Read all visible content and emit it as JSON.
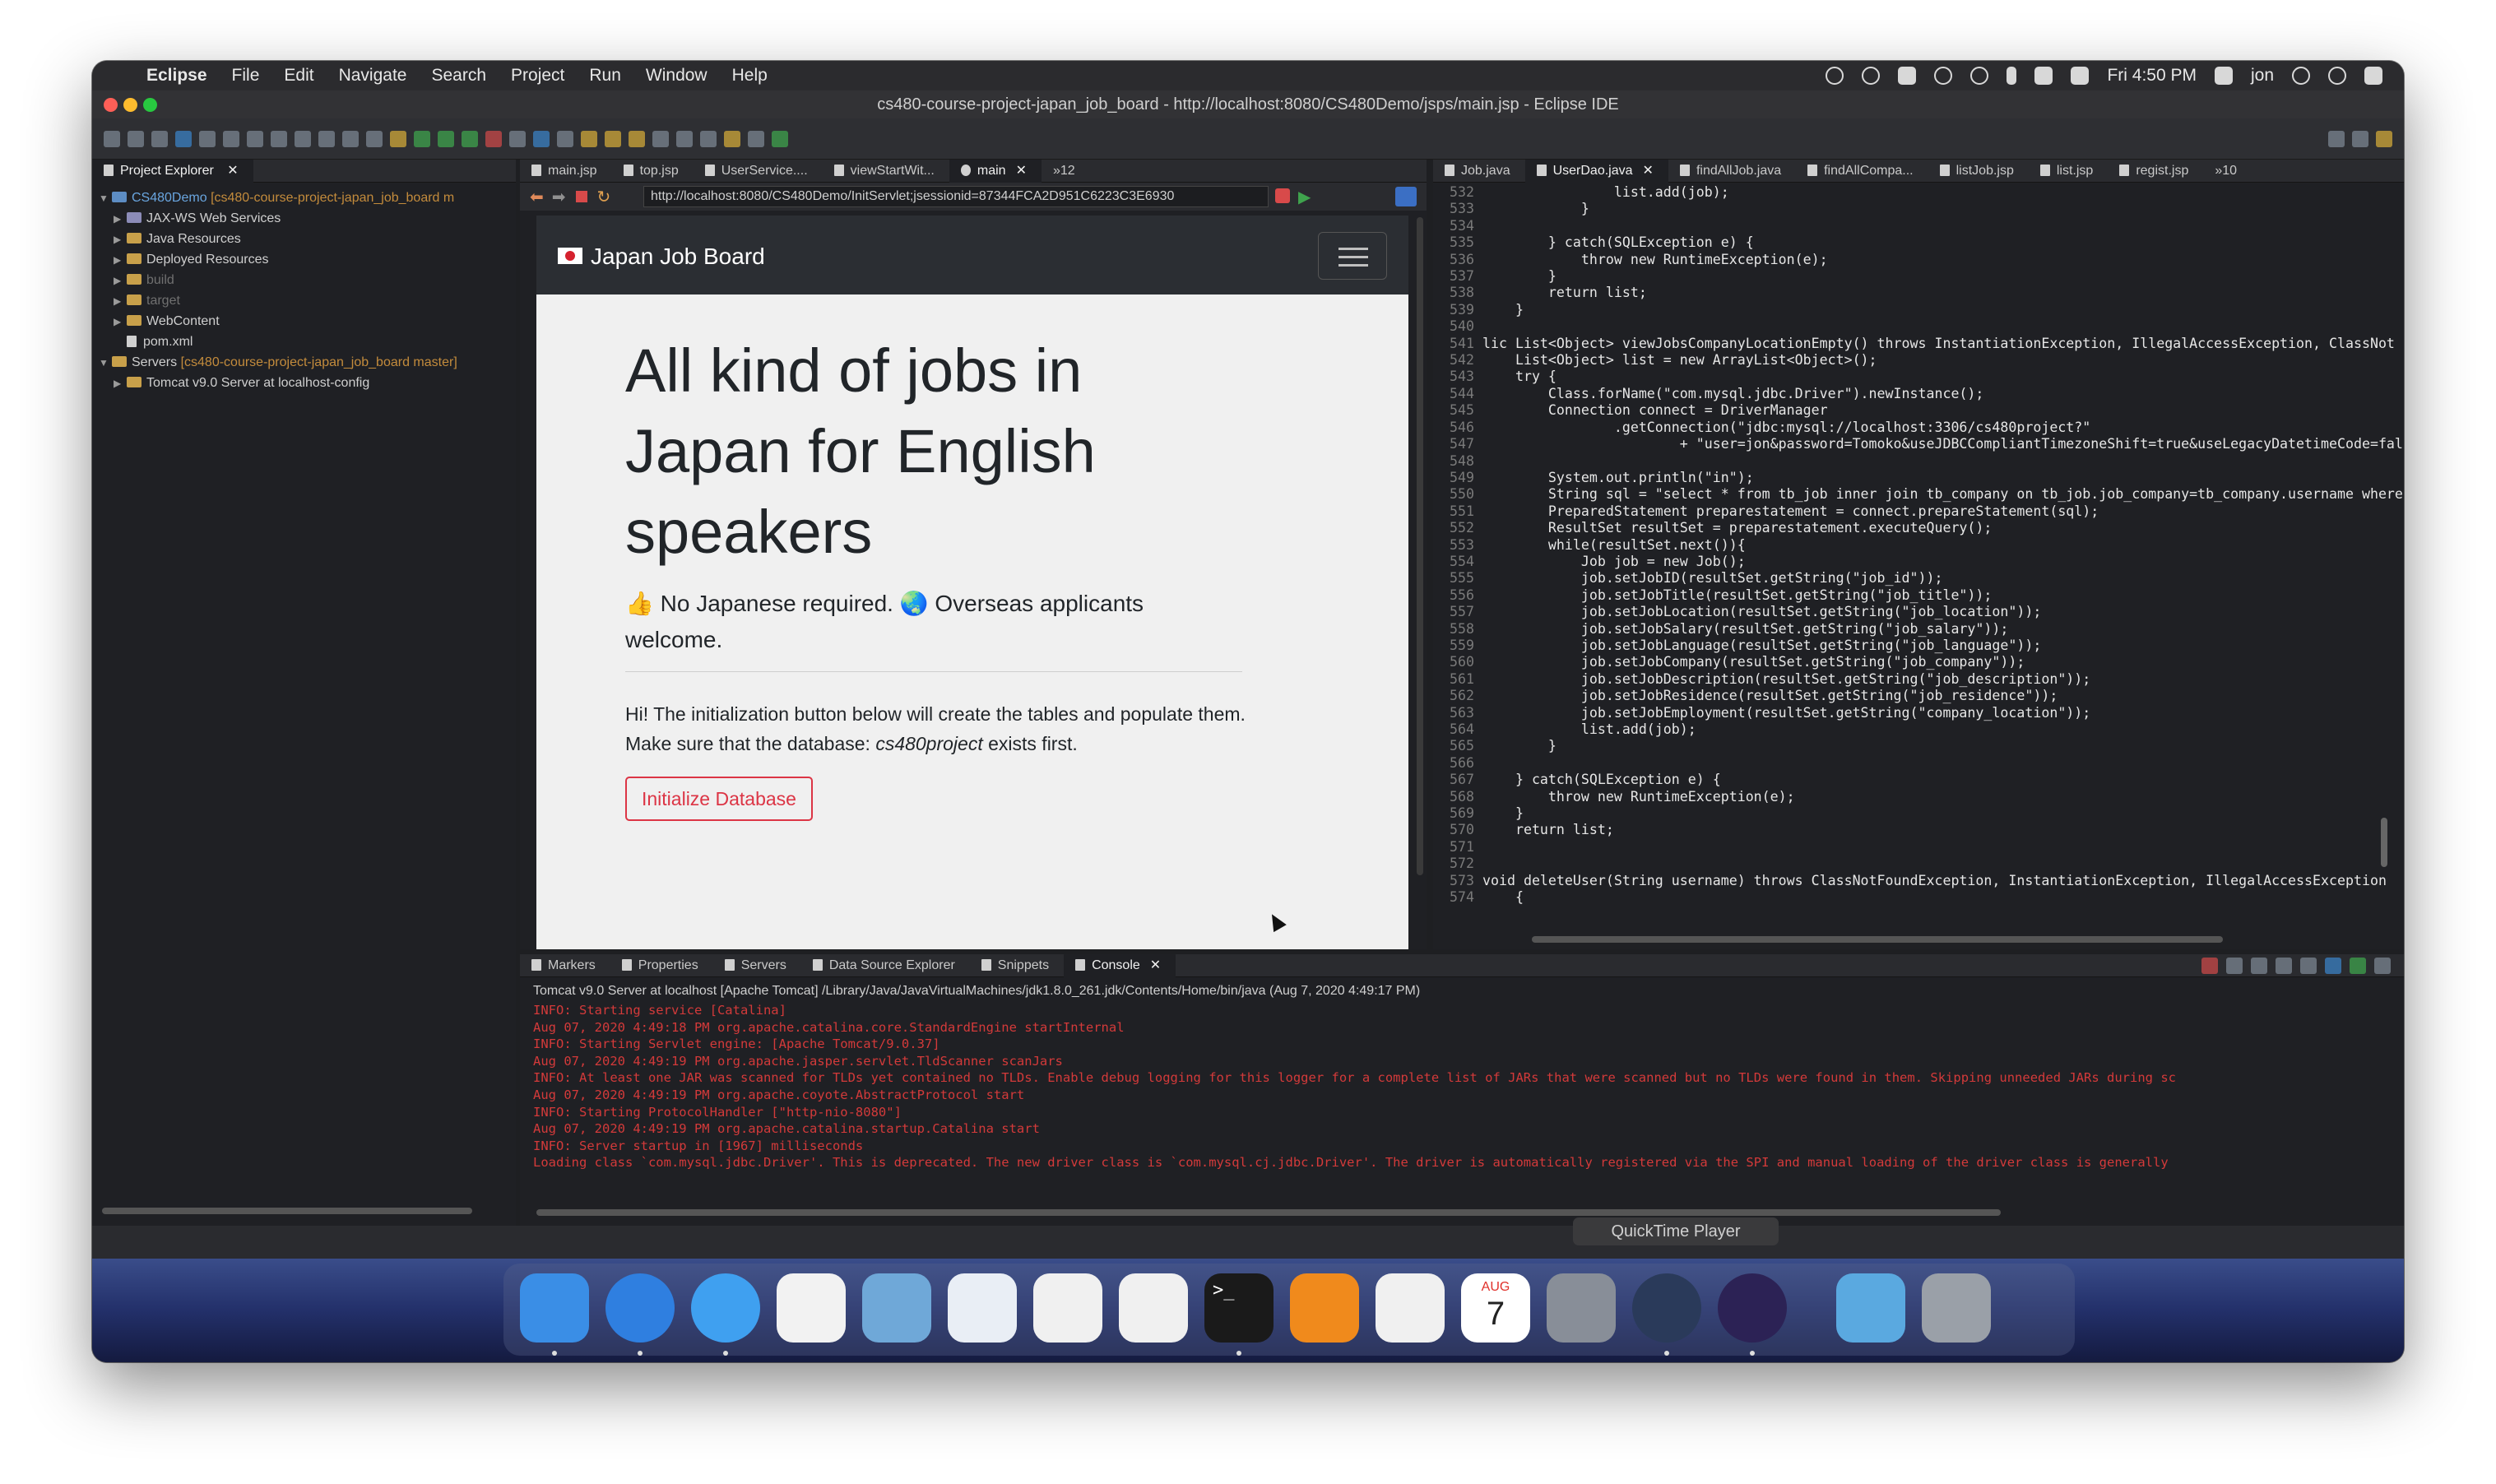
{
  "menubar": {
    "app": "Eclipse",
    "items": [
      "File",
      "Edit",
      "Navigate",
      "Search",
      "Project",
      "Run",
      "Window",
      "Help"
    ],
    "clock": "Fri 4:50 PM",
    "user": "jon"
  },
  "window_title": "cs480-course-project-japan_job_board - http://localhost:8080/CS480Demo/jsps/main.jsp - Eclipse IDE",
  "explorer": {
    "tab": "Project Explorer",
    "tree": [
      {
        "name": "CS480Demo",
        "extra": "[cs480-course-project-japan_job_board m"
      },
      {
        "name": "JAX-WS Web Services",
        "extra": ""
      },
      {
        "name": "Java Resources",
        "extra": ""
      },
      {
        "name": "Deployed Resources",
        "extra": ""
      },
      {
        "name": "build",
        "extra": ""
      },
      {
        "name": "target",
        "extra": ""
      },
      {
        "name": "WebContent",
        "extra": ""
      },
      {
        "name": "pom.xml",
        "extra": ""
      },
      {
        "name": "Servers",
        "extra": "[cs480-course-project-japan_job_board master]"
      },
      {
        "name": "Tomcat v9.0 Server at localhost-config",
        "extra": ""
      }
    ]
  },
  "browser": {
    "tabs": [
      "main.jsp",
      "top.jsp",
      "UserService....",
      "viewStartWit...",
      "main",
      "»12"
    ],
    "url": "http://localhost:8080/CS480Demo/InitServlet;jsessionid=87344FCA2D951C6223C3E6930",
    "page": {
      "brand": "Japan Job Board",
      "title": "All kind of jobs in Japan for English speakers",
      "lead": "👍 No Japanese required. 🌏 Overseas applicants welcome.",
      "text_before": "Hi! The initialization button below will create the tables and populate them. Make sure that the database: ",
      "db_name": "cs480project",
      "text_after": " exists first.",
      "button": "Initialize Database"
    }
  },
  "editor": {
    "tabs": [
      "Job.java",
      "UserDao.java",
      "findAllJob.java",
      "findAllCompa...",
      "listJob.jsp",
      "list.jsp",
      "regist.jsp",
      "»10"
    ],
    "lines": [
      {
        "n": "532",
        "t": "                list.add(job);"
      },
      {
        "n": "533",
        "t": "            }"
      },
      {
        "n": "534",
        "t": ""
      },
      {
        "n": "535",
        "t": "        } catch(SQLException e) {"
      },
      {
        "n": "536",
        "t": "            throw new RuntimeException(e);"
      },
      {
        "n": "537",
        "t": "        }"
      },
      {
        "n": "538",
        "t": "        return list;"
      },
      {
        "n": "539",
        "t": "    }"
      },
      {
        "n": "540",
        "t": ""
      },
      {
        "n": "541",
        "t": "lic List<Object> viewJobsCompanyLocationEmpty() throws InstantiationException, IllegalAccessException, ClassNot"
      },
      {
        "n": "542",
        "t": "    List<Object> list = new ArrayList<Object>();"
      },
      {
        "n": "543",
        "t": "    try {"
      },
      {
        "n": "544",
        "t": "        Class.forName(\"com.mysql.jdbc.Driver\").newInstance();"
      },
      {
        "n": "545",
        "t": "        Connection connect = DriverManager"
      },
      {
        "n": "546",
        "t": "                .getConnection(\"jdbc:mysql://localhost:3306/cs480project?\""
      },
      {
        "n": "547",
        "t": "                        + \"user=jon&password=Tomoko&useJDBCCompliantTimezoneShift=true&useLegacyDatetimeCode=fal"
      },
      {
        "n": "548",
        "t": ""
      },
      {
        "n": "549",
        "t": "        System.out.println(\"in\");"
      },
      {
        "n": "550",
        "t": "        String sql = \"select * from tb_job inner join tb_company on tb_job.job_company=tb_company.username where c"
      },
      {
        "n": "551",
        "t": "        PreparedStatement preparestatement = connect.prepareStatement(sql);"
      },
      {
        "n": "552",
        "t": "        ResultSet resultSet = preparestatement.executeQuery();"
      },
      {
        "n": "553",
        "t": "        while(resultSet.next()){"
      },
      {
        "n": "554",
        "t": "            Job job = new Job();"
      },
      {
        "n": "555",
        "t": "            job.setJobID(resultSet.getString(\"job_id\"));"
      },
      {
        "n": "556",
        "t": "            job.setJobTitle(resultSet.getString(\"job_title\"));"
      },
      {
        "n": "557",
        "t": "            job.setJobLocation(resultSet.getString(\"job_location\"));"
      },
      {
        "n": "558",
        "t": "            job.setJobSalary(resultSet.getString(\"job_salary\"));"
      },
      {
        "n": "559",
        "t": "            job.setJobLanguage(resultSet.getString(\"job_language\"));"
      },
      {
        "n": "560",
        "t": "            job.setJobCompany(resultSet.getString(\"job_company\"));"
      },
      {
        "n": "561",
        "t": "            job.setJobDescription(resultSet.getString(\"job_description\"));"
      },
      {
        "n": "562",
        "t": "            job.setJobResidence(resultSet.getString(\"job_residence\"));"
      },
      {
        "n": "563",
        "t": "            job.setJobEmployment(resultSet.getString(\"company_location\"));"
      },
      {
        "n": "564",
        "t": "            list.add(job);"
      },
      {
        "n": "565",
        "t": "        }"
      },
      {
        "n": "566",
        "t": ""
      },
      {
        "n": "567",
        "t": "    } catch(SQLException e) {"
      },
      {
        "n": "568",
        "t": "        throw new RuntimeException(e);"
      },
      {
        "n": "569",
        "t": "    }"
      },
      {
        "n": "570",
        "t": "    return list;"
      },
      {
        "n": "571",
        "t": ""
      },
      {
        "n": "572",
        "t": ""
      },
      {
        "n": "573",
        "t": "void deleteUser(String username) throws ClassNotFoundException, InstantiationException, IllegalAccessException"
      },
      {
        "n": "574",
        "t": "    {"
      }
    ]
  },
  "console": {
    "tabs": [
      "Markers",
      "Properties",
      "Servers",
      "Data Source Explorer",
      "Snippets",
      "Console"
    ],
    "header": "Tomcat v9.0 Server at localhost [Apache Tomcat] /Library/Java/JavaVirtualMachines/jdk1.8.0_261.jdk/Contents/Home/bin/java (Aug 7, 2020 4:49:17 PM)",
    "lines": [
      "INFO: Starting service [Catalina]",
      "Aug 07, 2020 4:49:18 PM org.apache.catalina.core.StandardEngine startInternal",
      "INFO: Starting Servlet engine: [Apache Tomcat/9.0.37]",
      "Aug 07, 2020 4:49:19 PM org.apache.jasper.servlet.TldScanner scanJars",
      "INFO: At least one JAR was scanned for TLDs yet contained no TLDs. Enable debug logging for this logger for a complete list of JARs that were scanned but no TLDs were found in them. Skipping unneeded JARs during sc",
      "Aug 07, 2020 4:49:19 PM org.apache.coyote.AbstractProtocol start",
      "INFO: Starting ProtocolHandler [\"http-nio-8080\"]",
      "Aug 07, 2020 4:49:19 PM org.apache.catalina.startup.Catalina start",
      "INFO: Server startup in [1967] milliseconds",
      "Loading class `com.mysql.jdbc.Driver'. This is deprecated. The new driver class is `com.mysql.cj.jdbc.Driver'. The driver is automatically registered via the SPI and manual loading of the driver class is generally"
    ]
  },
  "tooltip": "QuickTime Player",
  "dock": {
    "icons": [
      {
        "name": "finder-icon",
        "color": "#3a8ee6"
      },
      {
        "name": "safari-icon",
        "color": "#2f7fe0"
      },
      {
        "name": "messages-icon",
        "color": "#3fa0f0"
      },
      {
        "name": "reminders-icon",
        "color": "#f2f2f2"
      },
      {
        "name": "preview-icon",
        "color": "#6fa8d8"
      },
      {
        "name": "textedit-icon",
        "color": "#e9eef5"
      },
      {
        "name": "music-icon",
        "color": "#f0f0f0"
      },
      {
        "name": "news-icon",
        "color": "#f0f0f0"
      },
      {
        "name": "terminal-icon",
        "color": "#1a1a1a"
      },
      {
        "name": "books-icon",
        "color": "#f08a1c"
      },
      {
        "name": "photos-icon",
        "color": "#f0f0f0"
      },
      {
        "name": "calendar-icon",
        "color": "#ffffff"
      },
      {
        "name": "launchpad-icon",
        "color": "#888e98"
      },
      {
        "name": "quicktime-icon",
        "color": "#2a3a5a"
      },
      {
        "name": "eclipse-icon",
        "color": "#2c2255"
      },
      {
        "name": "downloads-folder-icon",
        "color": "#5aa9e0"
      },
      {
        "name": "trash-icon",
        "color": "#9aa0a8"
      }
    ],
    "calendar": {
      "month": "AUG",
      "day": "7"
    }
  }
}
